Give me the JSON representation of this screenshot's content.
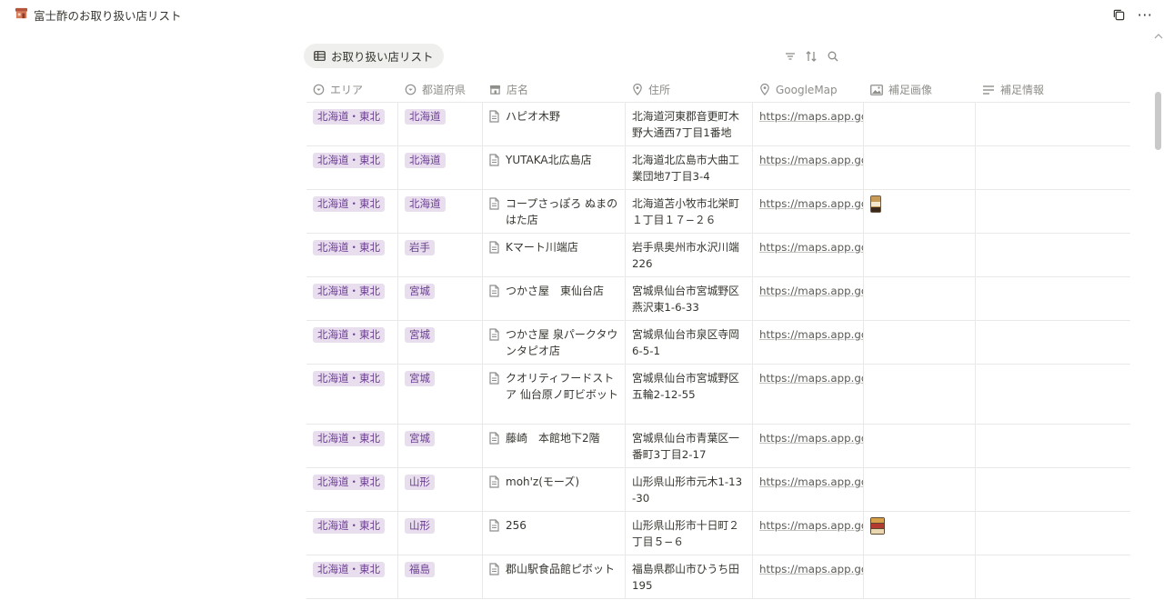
{
  "topbar": {
    "title": "富士酢のお取り扱い店リスト",
    "page_icon": "store-icon",
    "duplicate_icon": "duplicate-icon",
    "more_label": "···"
  },
  "view": {
    "tab_label": "お取り扱い店リスト",
    "tab_icon": "table-icon",
    "tools": [
      "filter-icon",
      "sort-icon",
      "search-icon"
    ]
  },
  "table": {
    "headers": [
      {
        "label": "エリア",
        "icon": "select-icon"
      },
      {
        "label": "都道府県",
        "icon": "select-icon"
      },
      {
        "label": "店名",
        "icon": "store-icon"
      },
      {
        "label": "住所",
        "icon": "location-pin-icon"
      },
      {
        "label": "GoogleMap",
        "icon": "location-pin-icon"
      },
      {
        "label": "補足画像",
        "icon": "image-icon"
      },
      {
        "label": "補足情報",
        "icon": "text-lines-icon"
      }
    ],
    "rows": [
      {
        "area": "北海道・東北",
        "pref": "北海道",
        "name": "ハピオ木野",
        "address": "北海道河東郡音更町木野大通西7丁目1番地",
        "map": "https://maps.app.goo.gl",
        "image": "",
        "info": ""
      },
      {
        "area": "北海道・東北",
        "pref": "北海道",
        "name": "YUTAKA北広島店",
        "address": "北海道北広島市大曲工業団地7丁目3-4",
        "map": "https://maps.app.goo.gl",
        "image": "",
        "info": ""
      },
      {
        "area": "北海道・東北",
        "pref": "北海道",
        "name": "コープさっぽろ ぬまのはた店",
        "address": "北海道苫小牧市北栄町１丁目１７−２６",
        "map": "https://maps.app.goo.gl",
        "image": "bottle-photo",
        "info": ""
      },
      {
        "area": "北海道・東北",
        "pref": "岩手",
        "name": "Kマート川端店",
        "address": "岩手県奥州市水沢川端226",
        "map": "https://maps.app.goo.gl",
        "image": "",
        "info": ""
      },
      {
        "area": "北海道・東北",
        "pref": "宮城",
        "name": "つかさ屋　東仙台店",
        "address": "宮城県仙台市宮城野区燕沢東1-6-33",
        "map": "https://maps.app.goo.gl",
        "image": "",
        "info": ""
      },
      {
        "area": "北海道・東北",
        "pref": "宮城",
        "name": "つかさ屋 泉パークタウンタピオ店",
        "address": "宮城県仙台市泉区寺岡6-5-1",
        "map": "https://maps.app.goo.gl",
        "image": "",
        "info": ""
      },
      {
        "area": "北海道・東北",
        "pref": "宮城",
        "name": "クオリティフードストア 仙台原ノ町ビボット",
        "address": "宮城県仙台市宮城野区五輪2-12-55",
        "map": "https://maps.app.goo.gl",
        "image": "",
        "info": ""
      },
      {
        "area": "北海道・東北",
        "pref": "宮城",
        "name": "藤崎　本館地下2階",
        "address": "宮城県仙台市青葉区一番町3丁目2-17",
        "map": "https://maps.app.goo.gl",
        "image": "",
        "info": ""
      },
      {
        "area": "北海道・東北",
        "pref": "山形",
        "name": "moh'z(モーズ)",
        "address": "山形県山形市元木1-13-30",
        "map": "https://maps.app.goo.gl",
        "image": "",
        "info": ""
      },
      {
        "area": "北海道・東北",
        "pref": "山形",
        "name": "256",
        "address": "山形県山形市十日町２丁目５−６",
        "map": "https://maps.app.goo.gl",
        "image": "shelf-photo",
        "info": ""
      },
      {
        "area": "北海道・東北",
        "pref": "福島",
        "name": "郡山駅食品館ピボット",
        "address": "福島県郡山市ひうち田195",
        "map": "https://maps.app.goo.gl",
        "image": "",
        "info": ""
      }
    ]
  },
  "colors": {
    "tag_bg": "#e8deee",
    "tag_text": "#6c3e93",
    "border": "#e9e9e7",
    "header_text": "#8f8e8a"
  }
}
